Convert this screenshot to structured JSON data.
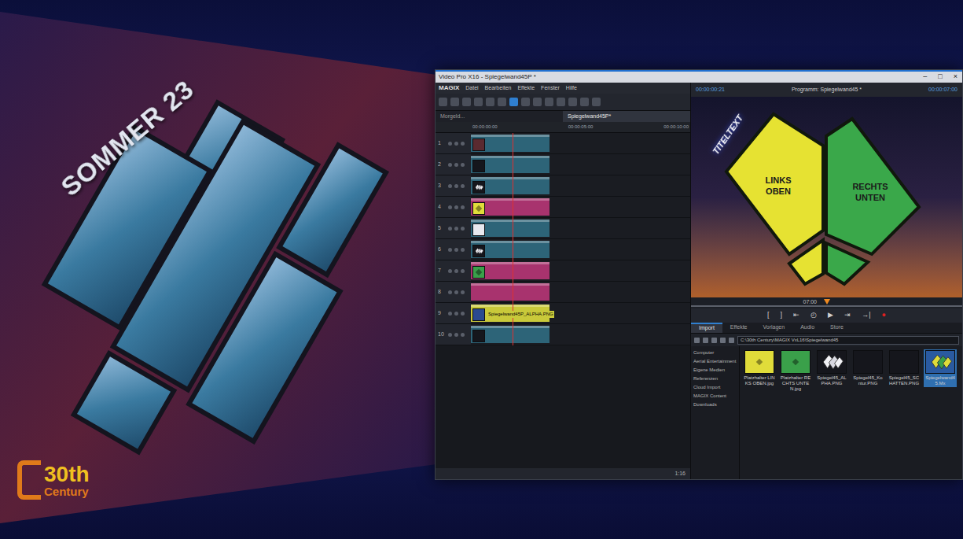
{
  "scene": {
    "poster_title": "SOMMER 23",
    "logo": {
      "number": "30th",
      "word": "Century"
    }
  },
  "window": {
    "title": "Video Pro X16 - Spiegelwand45P *",
    "controls": [
      "–",
      "□",
      "×"
    ]
  },
  "menu": {
    "brand": "MAGIX",
    "items": [
      "Datei",
      "Bearbeiten",
      "Effekte",
      "Fenster",
      "Hilfe"
    ]
  },
  "timeline": {
    "tabs": [
      {
        "label": "Morgeld...",
        "selected": false
      },
      {
        "label": "Spiegelwand45P*",
        "selected": true
      }
    ],
    "ruler": [
      "00:00:00:00",
      "00:00:05:00",
      "00:00:10:00"
    ],
    "playhead": 0.19,
    "zoom": "1:16",
    "tracks": [
      {
        "number": "1",
        "color": "#2d6478",
        "thumb": "dark-red",
        "level": 0.36
      },
      {
        "number": "2",
        "color": "#2d6478",
        "thumb": "dark",
        "level": 0.36
      },
      {
        "number": "3",
        "color": "#2d6478",
        "thumb": "diamonds",
        "level": 0.36
      },
      {
        "number": "4",
        "color": "#a8336e",
        "thumb": "yellow",
        "level": 0.36
      },
      {
        "number": "5",
        "color": "#2d6478",
        "thumb": "white",
        "level": 0.36
      },
      {
        "number": "6",
        "color": "#2d6478",
        "thumb": "diamonds",
        "level": 0.36
      },
      {
        "number": "7",
        "color": "#a8336e",
        "thumb": "green",
        "level": 0.36
      },
      {
        "number": "8",
        "color": "#a8336e",
        "thumb": "none",
        "level": 0.36
      },
      {
        "number": "9",
        "color": "#c9c93a",
        "thumb": "bar",
        "level": 0.36,
        "label": "Spiegelwand45P_ALPHA.PNG"
      },
      {
        "number": "10",
        "color": "#2d6478",
        "thumb": "dark",
        "level": 0.36
      }
    ]
  },
  "monitor": {
    "timecode": "00:00:00:21",
    "title": "Programm: Spiegelwand45 *",
    "total": "00:00:07:00",
    "badge": "TITELTEXT",
    "left_label": "LINKS OBEN",
    "right_label": "RECHTS UNTEN",
    "position": "07:00",
    "progress": 0.5
  },
  "transport": [
    {
      "glyph": "[",
      "kind": "normal"
    },
    {
      "glyph": "]",
      "kind": "normal"
    },
    {
      "glyph": "⇤",
      "kind": "normal"
    },
    {
      "glyph": "◴",
      "kind": "normal"
    },
    {
      "glyph": "▶",
      "kind": "normal"
    },
    {
      "glyph": "⇥",
      "kind": "normal"
    },
    {
      "glyph": "→|",
      "kind": "normal"
    },
    {
      "glyph": "●",
      "kind": "record"
    }
  ],
  "media": {
    "tabs": [
      {
        "label": "Import",
        "selected": true
      },
      {
        "label": "Effekte",
        "selected": false
      },
      {
        "label": "Vorlagen",
        "selected": false
      },
      {
        "label": "Audio",
        "selected": false
      },
      {
        "label": "Store",
        "selected": false
      }
    ],
    "path": "C:\\30th Century\\MAGIX VxL16\\Spiegelwand45",
    "sidebar": [
      "Computer",
      "Aerial Entertainment",
      "Eigene Medien",
      "Referenzen",
      "Cloud Import",
      "MAGIX Content",
      "Downloads"
    ],
    "files": [
      {
        "name": "Platzhalter LINKS OBEN.jpg",
        "thumb": "yellow",
        "selected": false
      },
      {
        "name": "Platzhalter RECHTS UNTEN.jpg",
        "thumb": "green",
        "selected": false
      },
      {
        "name": "Spiegel45_ALPHA.PNG",
        "thumb": "diamonds",
        "selected": false
      },
      {
        "name": "Spiegel45_Kontur.PNG",
        "thumb": "dark",
        "selected": false
      },
      {
        "name": "Spiegel45_SCHATTEN.PNG",
        "thumb": "dark",
        "selected": false
      },
      {
        "name": "Spiegelwand45.Mx",
        "thumb": "project",
        "selected": true
      }
    ]
  }
}
